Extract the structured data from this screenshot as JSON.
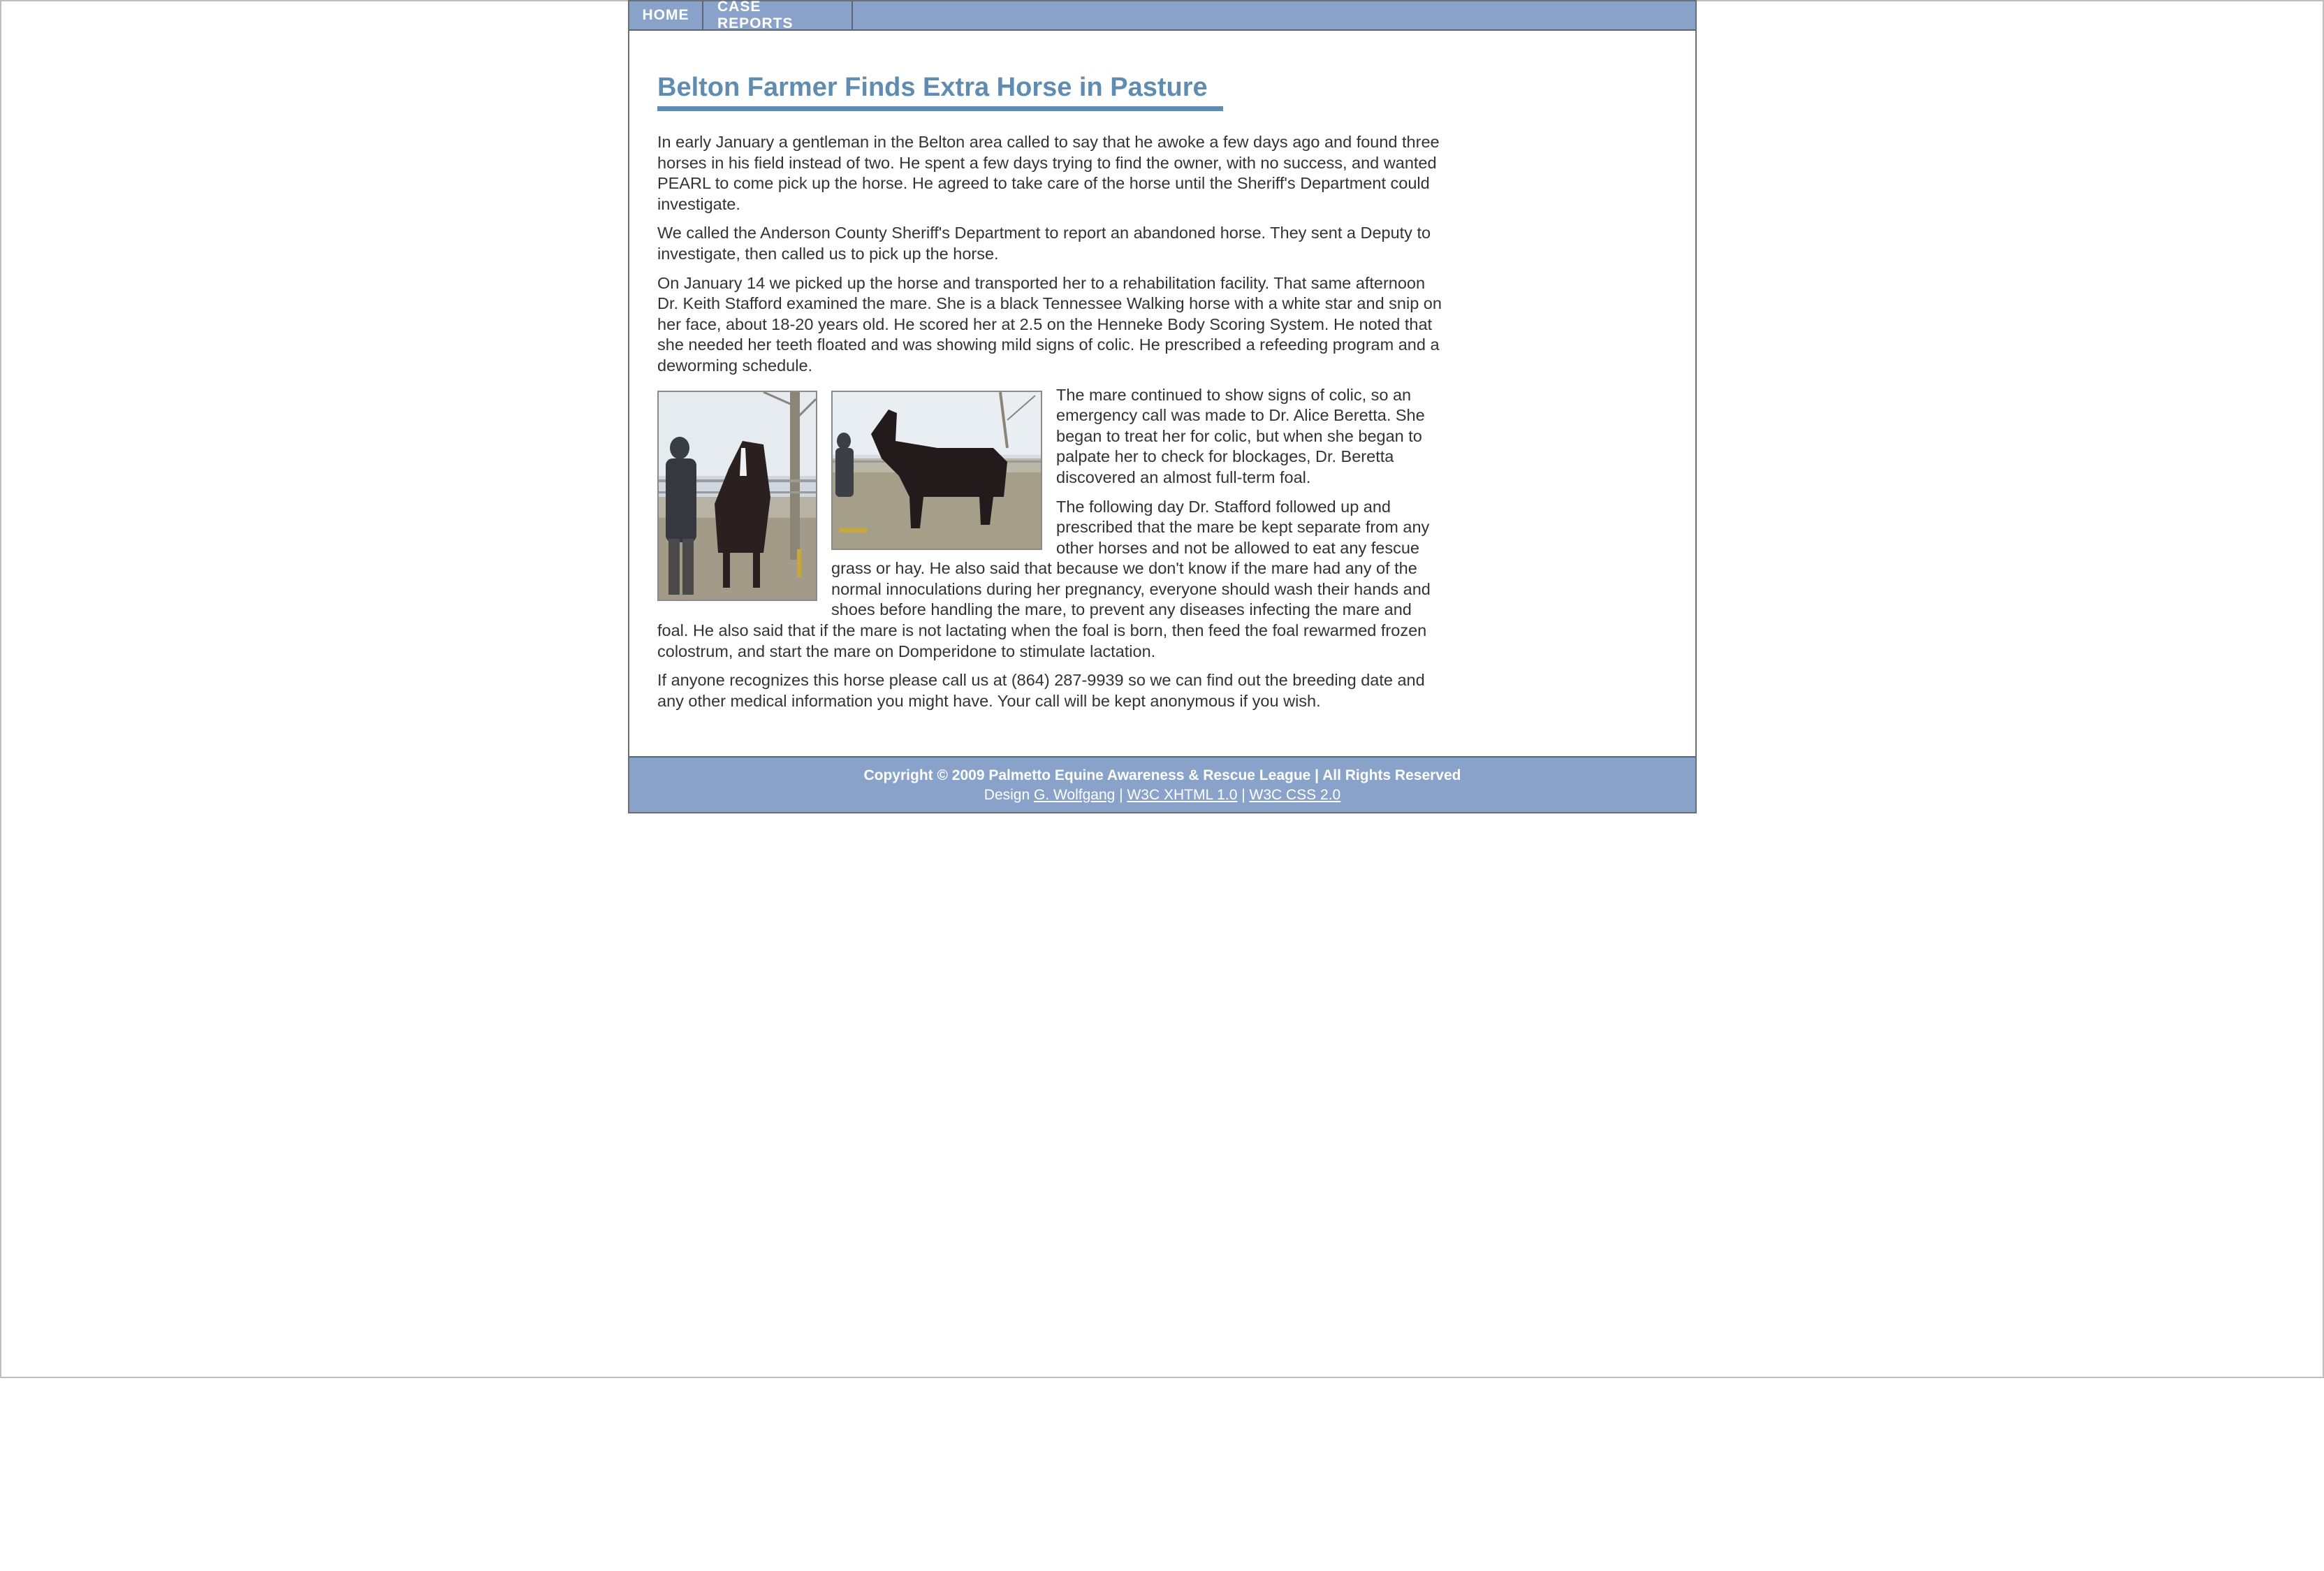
{
  "nav": {
    "items": [
      {
        "label": "HOME"
      },
      {
        "label": "CASE REPORTS"
      }
    ]
  },
  "article": {
    "title": "Belton Farmer Finds Extra Horse in Pasture",
    "paragraphs": [
      "In early January a gentleman in the Belton area called to say that he awoke a few days ago and found three horses in his field instead of two. He spent a few days trying to find the owner, with no success, and wanted PEARL to come pick up the horse. He agreed to take care of the horse until the Sheriff's Department could investigate.",
      "We called the Anderson County Sheriff's Department to report an abandoned horse. They sent a Deputy to investigate, then called us to pick up the horse.",
      "On January 14 we picked up the horse and transported her to a rehabilitation facility. That same afternoon Dr. Keith Stafford examined the mare. She is a black Tennessee Walking horse with a white star and snip on her face, about 18-20 years old. He scored her at 2.5 on the Henneke Body Scoring System. He noted that she needed her teeth floated and was showing mild signs of colic. He prescribed a refeeding program and a deworming schedule.",
      "The mare continued to show signs of colic, so an emergency call was made to Dr. Alice Beretta. She began to treat her for colic, but when she began to palpate her to check for blockages, Dr. Beretta discovered an almost full-term foal.",
      "The following day Dr. Stafford followed up and prescribed that the mare be kept separate from any other horses and not be allowed to eat any fescue grass or hay. He also said that because we don't know if the mare had any of the normal innoculations during her pregnancy, everyone should wash their hands and shoes before handling the mare, to prevent any diseases infecting the mare and foal. He also said that if the mare is not lactating when the foal is born, then feed the foal rewarmed frozen colostrum, and start the mare on Domperidone to stimulate lactation.",
      "If anyone recognizes this horse please call us at (864) 287-9939 so we can find out the breeding date and any other medical information you might have. Your call will be kept anonymous if you wish."
    ]
  },
  "footer": {
    "copyright": "Copyright © 2009 Palmetto Equine Awareness & Rescue League | All Rights Reserved",
    "design_prefix": "Design ",
    "designer_link": "G. Wolfgang",
    "sep1": " | ",
    "xhtml_link": "W3C XHTML 1.0",
    "sep2": " | ",
    "css_link": "W3C CSS 2.0"
  }
}
